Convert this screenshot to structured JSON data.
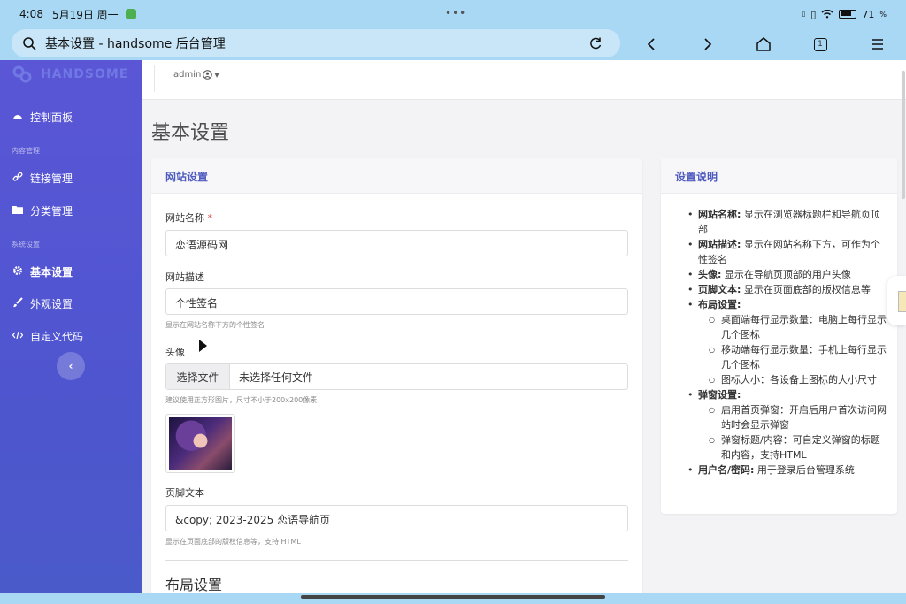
{
  "status": {
    "time": "4:08",
    "date": "5月19日 周一",
    "battery": "71"
  },
  "browser": {
    "title": "基本设置 - handsome 后台管理",
    "tab_count": "1"
  },
  "sidebar": {
    "brand": "HANDSOME",
    "items": [
      {
        "label": "控制面板"
      },
      {
        "label": "链接管理"
      },
      {
        "label": "分类管理"
      },
      {
        "label": "基本设置"
      },
      {
        "label": "外观设置"
      },
      {
        "label": "自定义代码"
      }
    ],
    "sections": [
      "内容管理",
      "系统设置"
    ],
    "collapse": "‹"
  },
  "topbar": {
    "user": "admin"
  },
  "main": {
    "page_title": "基本设置",
    "form": {
      "header": "网站设置",
      "site_name_label": "网站名称",
      "required_mark": "*",
      "site_name_value": "恋语源码网",
      "site_desc_label": "网站描述",
      "site_desc_value": "个性签名",
      "site_desc_hint": "显示在网站名称下方的个性签名",
      "avatar_label": "头像",
      "file_button": "选择文件",
      "file_status": "未选择任何文件",
      "avatar_hint": "建议使用正方形图片，尺寸不小于200x200像素",
      "footer_label": "页脚文本",
      "footer_value": "&copy; 2023-2025 恋语导航页",
      "footer_hint": "显示在页面底部的版权信息等，支持 HTML",
      "layout_title": "布局设置"
    },
    "info": {
      "header": "设置说明",
      "items": [
        {
          "term": "网站名称:",
          "desc": "显示在浏览器标题栏和导航页顶部"
        },
        {
          "term": "网站描述:",
          "desc": "显示在网站名称下方，可作为个性签名"
        },
        {
          "term": "头像:",
          "desc": "显示在导航页顶部的用户头像"
        },
        {
          "term": "页脚文本:",
          "desc": "显示在页面底部的版权信息等"
        },
        {
          "term": "布局设置:",
          "desc": ""
        },
        {
          "term": "弹窗设置:",
          "desc": ""
        },
        {
          "term": "用户名/密码:",
          "desc": "用于登录后台管理系统"
        }
      ],
      "layout_sub": [
        "桌面端每行显示数量：电脑上每行显示几个图标",
        "移动端每行显示数量：手机上每行显示几个图标",
        "图标大小：各设备上图标的大小尺寸"
      ],
      "popup_sub": [
        "启用首页弹窗：开启后用户首次访问网站时会显示弹窗",
        "弹窗标题/内容：可自定义弹窗的标题和内容，支持HTML"
      ]
    }
  }
}
